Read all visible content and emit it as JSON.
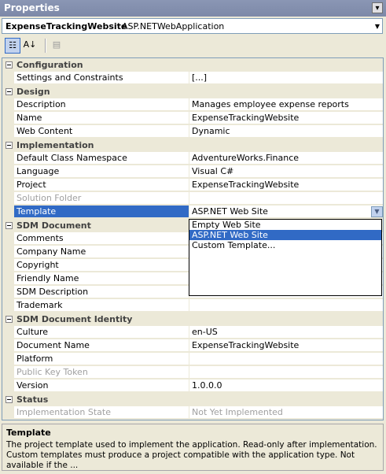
{
  "window": {
    "title": "Properties",
    "close_glyph": "▾"
  },
  "object_selector": {
    "name": "ExpenseTrackingWebsite",
    "type": "ASP.NETWebApplication"
  },
  "toolbar": {
    "categorized_glyph": "☷",
    "alphabetical_glyph": "A↓",
    "pages_glyph": "▤"
  },
  "grid": {
    "rows": [
      {
        "kind": "category",
        "label": "Configuration"
      },
      {
        "kind": "prop",
        "name": "Settings and Constraints",
        "value": "[...]"
      },
      {
        "kind": "category",
        "label": "Design"
      },
      {
        "kind": "prop",
        "name": "Description",
        "value": "Manages employee expense reports"
      },
      {
        "kind": "prop",
        "name": "Name",
        "value": "ExpenseTrackingWebsite"
      },
      {
        "kind": "prop",
        "name": "Web Content",
        "value": "Dynamic"
      },
      {
        "kind": "category",
        "label": "Implementation"
      },
      {
        "kind": "prop",
        "name": "Default Class Namespace",
        "value": "AdventureWorks.Finance"
      },
      {
        "kind": "prop",
        "name": "Language",
        "value": "Visual C#"
      },
      {
        "kind": "prop",
        "name": "Project",
        "value": "ExpenseTrackingWebsite"
      },
      {
        "kind": "prop",
        "name": "Solution Folder",
        "value": "",
        "disabled": true
      },
      {
        "kind": "prop",
        "name": "Template",
        "value": "ASP.NET Web Site",
        "selected": true
      },
      {
        "kind": "category",
        "label": "SDM Document"
      },
      {
        "kind": "prop",
        "name": "Comments",
        "value": ""
      },
      {
        "kind": "prop",
        "name": "Company Name",
        "value": ""
      },
      {
        "kind": "prop",
        "name": "Copyright",
        "value": ""
      },
      {
        "kind": "prop",
        "name": "Friendly Name",
        "value": ""
      },
      {
        "kind": "prop",
        "name": "SDM Description",
        "value": ""
      },
      {
        "kind": "prop",
        "name": "Trademark",
        "value": ""
      },
      {
        "kind": "category",
        "label": "SDM Document Identity"
      },
      {
        "kind": "prop",
        "name": "Culture",
        "value": "en-US"
      },
      {
        "kind": "prop",
        "name": "Document Name",
        "value": "ExpenseTrackingWebsite"
      },
      {
        "kind": "prop",
        "name": "Platform",
        "value": ""
      },
      {
        "kind": "prop",
        "name": "Public Key Token",
        "value": "",
        "disabled": true
      },
      {
        "kind": "prop",
        "name": "Version",
        "value": "1.0.0.0"
      },
      {
        "kind": "category",
        "label": "Status"
      },
      {
        "kind": "prop",
        "name": "Implementation State",
        "value": "Not Yet Implemented",
        "disabled": true
      }
    ]
  },
  "dropdown": {
    "button_glyph": "▼",
    "options": [
      "Empty Web Site",
      "ASP.NET Web Site",
      "Custom Template..."
    ],
    "highlighted_index": 1
  },
  "description": {
    "heading": "Template",
    "body": "The project template used to implement the application.  Read-only after implementation.  Custom templates  must produce a project compatible with the application type.  Not available if the ..."
  }
}
